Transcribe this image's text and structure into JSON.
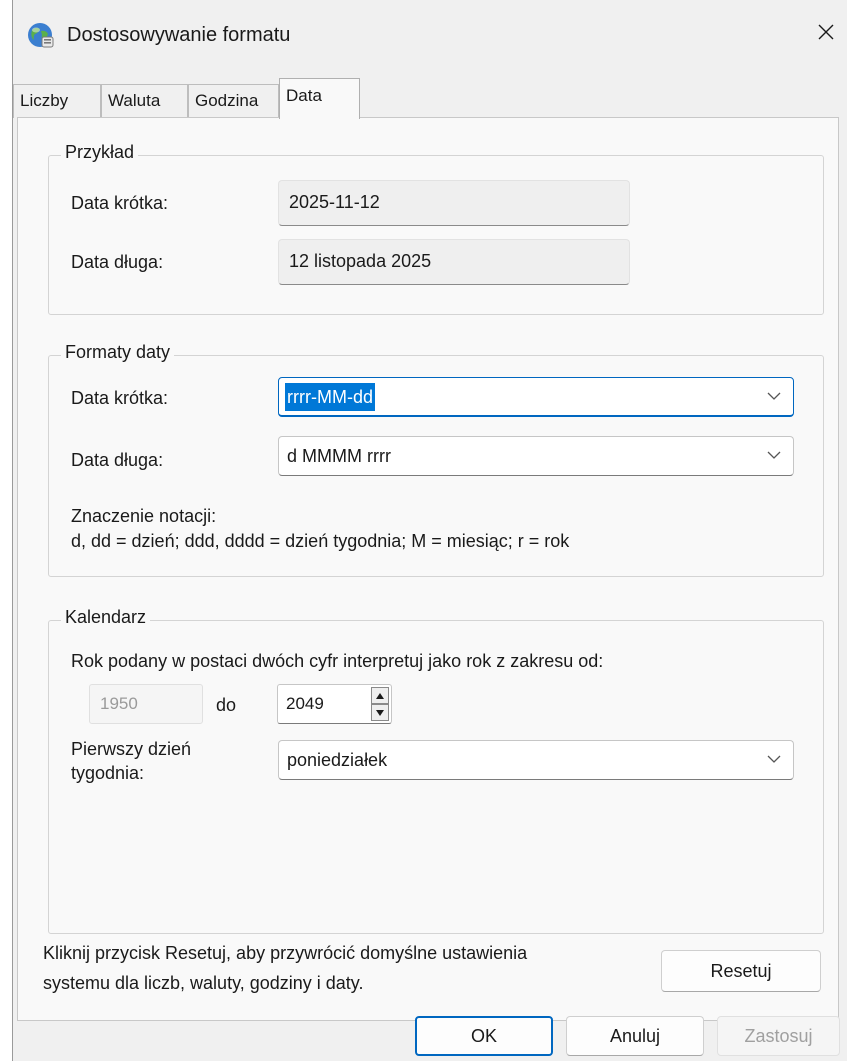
{
  "window": {
    "title": "Dostosowywanie formatu",
    "icon": "globe-icon"
  },
  "tabs": [
    {
      "label": "Liczby",
      "active": false
    },
    {
      "label": "Waluta",
      "active": false
    },
    {
      "label": "Godzina",
      "active": false
    },
    {
      "label": "Data",
      "active": true
    }
  ],
  "example": {
    "legend": "Przykład",
    "short_label": "Data krótka:",
    "short_value": "2025-11-12",
    "long_label": "Data długa:",
    "long_value": "12 listopada 2025"
  },
  "formats": {
    "legend": "Formaty daty",
    "short_label": "Data krótka:",
    "short_value": "rrrr-MM-dd",
    "long_label": "Data długa:",
    "long_value": "d MMMM rrrr",
    "notation_title": "Znaczenie notacji:",
    "notation_text": "d, dd = dzień;  ddd, dddd = dzień tygodnia;  M = miesiąc;  r = rok"
  },
  "calendar": {
    "legend": "Kalendarz",
    "range_text": "Rok podany w postaci dwóch cyfr interpretuj jako rok z zakresu od:",
    "from_value": "1950",
    "to_label": "do",
    "to_value": "2049",
    "first_day_label_line1": "Pierwszy dzień",
    "first_day_label_line2": "tygodnia:",
    "first_day_value": "poniedziałek"
  },
  "reset": {
    "text_line1": "Kliknij przycisk Resetuj, aby przywrócić domyślne ustawienia",
    "text_line2": "systemu dla liczb, waluty, godziny i daty.",
    "button": "Resetuj"
  },
  "buttons": {
    "ok": "OK",
    "cancel": "Anuluj",
    "apply": "Zastosuj"
  },
  "colors": {
    "accent": "#0067c0",
    "selection": "#0078d7"
  }
}
